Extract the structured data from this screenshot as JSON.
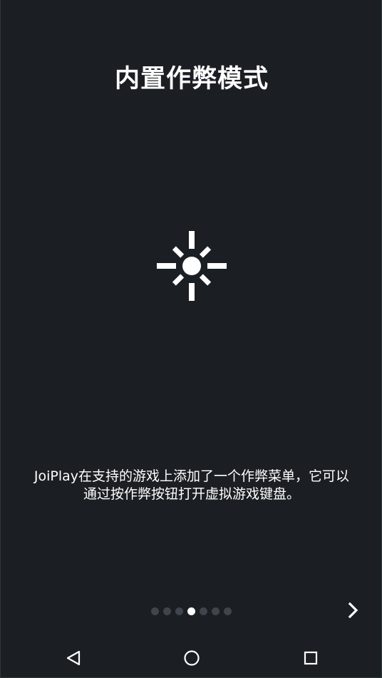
{
  "onboarding": {
    "title": "内置作弊模式",
    "hero_icon": "brightness-sun-icon",
    "description_line1": "JoiPlay在支持的游戏上添加了一个作弊菜单，它可以",
    "description_line2": "通过按作弊按钮打开虚拟游戏键盘。",
    "pager": {
      "total_pages": 7,
      "current_page": 4
    },
    "next_icon": "chevron-right-icon"
  },
  "navigation_bar": {
    "back_icon": "triangle-back-icon",
    "home_icon": "circle-home-icon",
    "recents_icon": "square-recents-icon"
  },
  "colors": {
    "background": "#1b1f23",
    "text": "#ffffff",
    "dot_inactive": "#3f454b",
    "dot_active": "#ffffff"
  }
}
